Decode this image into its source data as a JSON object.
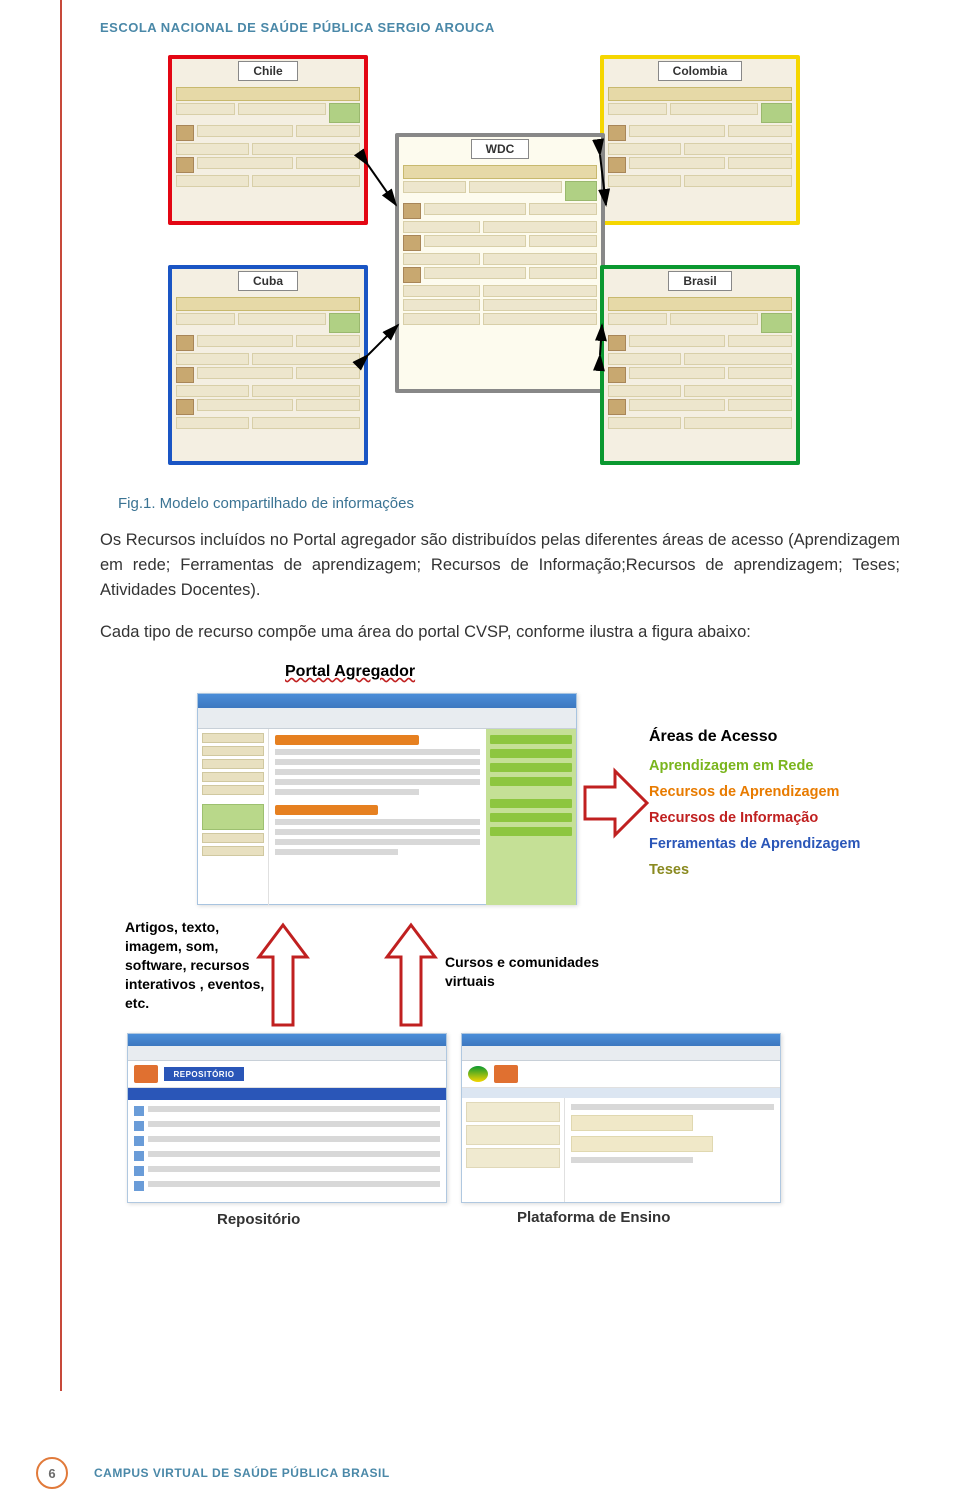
{
  "header": {
    "title": "ESCOLA NACIONAL DE SAÚDE PÚBLICA SERGIO AROUCA"
  },
  "fig1": {
    "caption": "Fig.1. Modelo compartilhado de informações",
    "nodes": {
      "chile": "Chile",
      "colombia": "Colombia",
      "cuba": "Cuba",
      "brasil": "Brasil",
      "wdc": "WDC"
    }
  },
  "body": {
    "para1": "Os Recursos incluídos no Portal agregador são distribuídos pelas diferentes áreas de acesso (Aprendizagem em rede; Ferramentas de aprendizagem; Recursos de Informação;Recursos de aprendizagem; Teses; Atividades Docentes).",
    "para2": "Cada tipo de recurso compõe uma área do portal CVSP, conforme ilustra a figura abaixo:"
  },
  "fig2": {
    "portal_label": "Portal Agregador",
    "areas_label": "Áreas de Acesso",
    "areas": {
      "a1": "Aprendizagem em Rede",
      "a2": "Recursos de Aprendizagem",
      "a3": "Recursos de Informação",
      "a4": "Ferramentas de  Aprendizagem",
      "a5": "Teses"
    },
    "artigos": "Artigos, texto, imagem, som, software, recursos interativos , eventos, etc.",
    "cursos": "Cursos e comunidades virtuais",
    "repo_label": "Repositório",
    "plat_label": "Plataforma de  Ensino",
    "repo_badge": "REPOSITÓRIO"
  },
  "footer": {
    "page": "6",
    "text": "CAMPUS VIRTUAL DE SAÚDE PÚBLICA BRASIL"
  }
}
